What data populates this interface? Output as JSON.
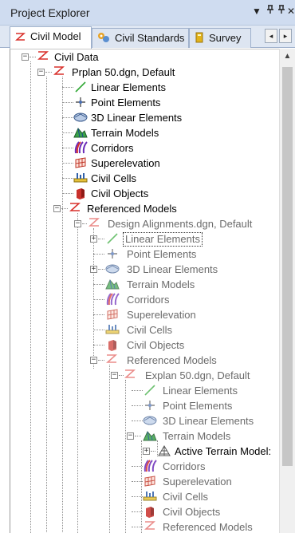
{
  "panel": {
    "title": "Project Explorer",
    "buttons": {
      "dropdown": "▼",
      "pin": "⊓",
      "pin2": "⊓",
      "close": "✕"
    }
  },
  "tabs": [
    {
      "label": "Civil Model",
      "icon": "civil-z-icon",
      "active": true
    },
    {
      "label": "Civil Standards",
      "icon": "standards-icon",
      "active": false
    },
    {
      "label": "Survey",
      "icon": "survey-icon",
      "active": false
    }
  ],
  "tab_scroll": {
    "left": "◂",
    "right": "▸"
  },
  "tree": {
    "root": "Civil Data",
    "file1": "Prplan 50.dgn, Default",
    "linear": "Linear Elements",
    "point": "Point Elements",
    "linear3d": "3D Linear Elements",
    "terrain": "Terrain Models",
    "corridors": "Corridors",
    "superelevation": "Superelevation",
    "cells": "Civil Cells",
    "objects": "Civil Objects",
    "refmodels": "Referenced Models",
    "file2": "Design Alignments.dgn, Default",
    "file3": "Explan 50.dgn, Default",
    "active_terrain": "Active Terrain Model:"
  },
  "colors": {
    "titlebar": "#cfdcf0",
    "tabstrip": "#dfe7f3",
    "z_icon": "#d9302b"
  }
}
